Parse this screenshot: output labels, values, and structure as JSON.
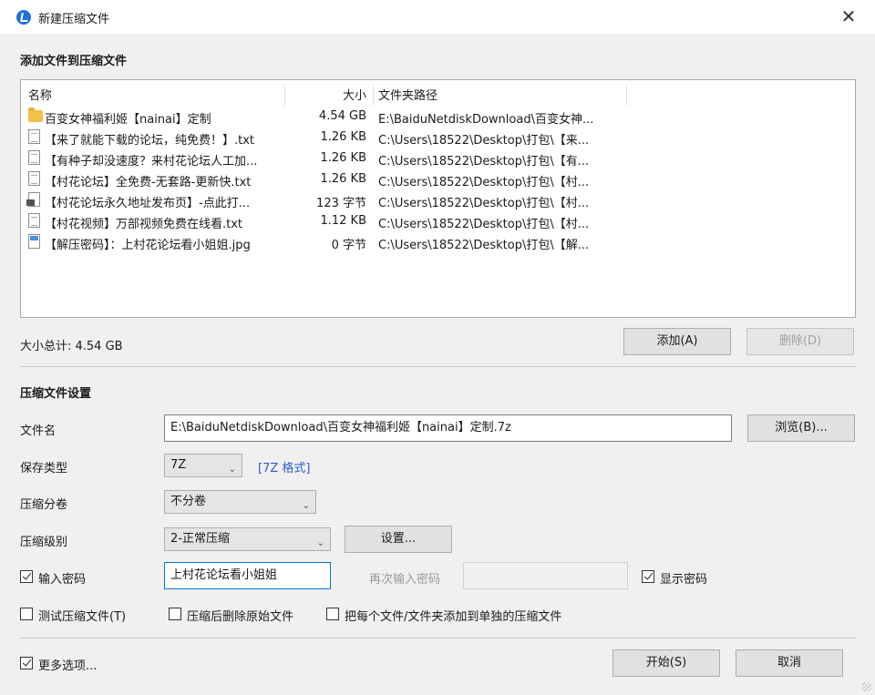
{
  "window": {
    "title": "新建压缩文件"
  },
  "add_section": {
    "heading": "添加文件到压缩文件"
  },
  "filelist": {
    "columns": {
      "name": "名称",
      "size": "大小",
      "path": "文件夹路径"
    },
    "rows": [
      {
        "icon": "folder-icon",
        "name": "百变女神福利姬【nainai】定制",
        "size": "4.54 GB",
        "path": "E:\\BaiduNetdiskDownload\\百变女神..."
      },
      {
        "icon": "text-file-icon",
        "name": "【来了就能下载的论坛，纯免费！】.txt",
        "size": "1.26 KB",
        "path": "C:\\Users\\18522\\Desktop\\打包\\【来..."
      },
      {
        "icon": "text-file-icon",
        "name": "【有种子却没速度？来村花论坛人工加...",
        "size": "1.26 KB",
        "path": "C:\\Users\\18522\\Desktop\\打包\\【有..."
      },
      {
        "icon": "text-file-icon",
        "name": "【村花论坛】全免费-无套路-更新快.txt",
        "size": "1.26 KB",
        "path": "C:\\Users\\18522\\Desktop\\打包\\【村..."
      },
      {
        "icon": "url-shortcut-icon",
        "name": "【村花论坛永久地址发布页】-点此打...",
        "size": "123 字节",
        "path": "C:\\Users\\18522\\Desktop\\打包\\【村..."
      },
      {
        "icon": "text-file-icon",
        "name": "【村花视频】万部视频免费在线看.txt",
        "size": "1.12 KB",
        "path": "C:\\Users\\18522\\Desktop\\打包\\【村..."
      },
      {
        "icon": "image-file-icon",
        "name": "【解压密码】：上村花论坛看小姐姐.jpg",
        "size": "0 字节",
        "path": "C:\\Users\\18522\\Desktop\\打包\\【解..."
      }
    ]
  },
  "summary": {
    "total_size": "大小总计: 4.54 GB"
  },
  "buttons": {
    "add": "添加(A)",
    "remove": "删除(D)",
    "browse": "浏览(B)...",
    "settings": "设置...",
    "start": "开始(S)",
    "cancel": "取消"
  },
  "settings_section": {
    "heading": "压缩文件设置"
  },
  "fields": {
    "filename_label": "文件名",
    "filename_value": "E:\\BaiduNetdiskDownload\\百变女神福利姬【nainai】定制.7z",
    "save_type_label": "保存类型",
    "save_type_value": "7Z",
    "format_link": "[7Z 格式]",
    "split_label": "压缩分卷",
    "split_value": "不分卷",
    "level_label": "压缩级别",
    "level_value": "2-正常压缩",
    "password_label": "输入密码",
    "password_value": "上村花论坛看小姐姐",
    "password_repeat_label": "再次输入密码",
    "password_repeat_value": "",
    "show_password_label": "显示密码"
  },
  "options": {
    "test_archive": "测试压缩文件(T)",
    "delete_after": "压缩后删除原始文件",
    "separate_archives": "把每个文件/文件夹添加到单独的压缩文件",
    "more_options": "更多选项..."
  }
}
